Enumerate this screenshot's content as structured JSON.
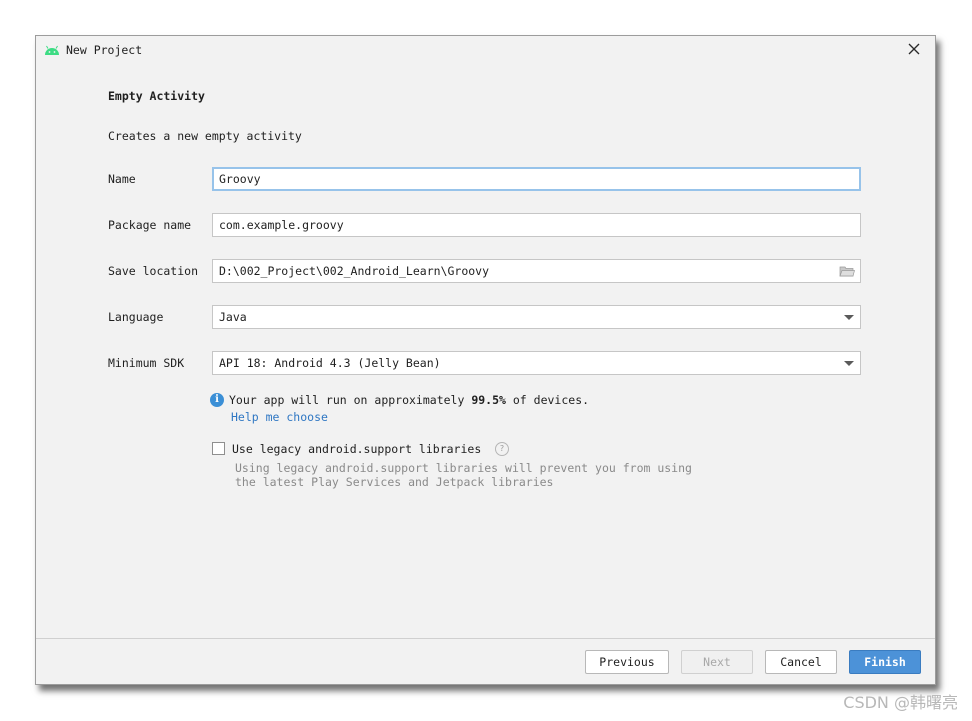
{
  "window": {
    "title": "New Project",
    "close_glyph": "✕"
  },
  "form": {
    "heading": "Empty Activity",
    "description": "Creates a new empty activity",
    "name_label": "Name",
    "name_value": "Groovy",
    "package_label": "Package name",
    "package_value": "com.example.groovy",
    "location_label": "Save location",
    "location_value": "D:\\002_Project\\002_Android_Learn\\Groovy",
    "language_label": "Language",
    "language_value": "Java",
    "sdk_label": "Minimum SDK",
    "sdk_value": "API 18: Android 4.3 (Jelly Bean)"
  },
  "info": {
    "icon_glyph": "i",
    "text_prefix": "Your app will run on approximately ",
    "percent": "99.5%",
    "text_suffix": " of devices.",
    "help_link": "Help me choose"
  },
  "legacy": {
    "checkbox_label": "Use legacy android.support libraries",
    "checked": false,
    "question_glyph": "?",
    "hint_line1": "Using legacy android.support libraries will prevent you from using",
    "hint_line2": "the latest Play Services and Jetpack libraries"
  },
  "buttons": {
    "previous": "Previous",
    "next": "Next",
    "cancel": "Cancel",
    "finish": "Finish"
  },
  "watermark": "CSDN @韩曙亮",
  "colors": {
    "android_green": "#3ddc84",
    "accent_blue": "#4c92d8",
    "link_blue": "#2f77c3",
    "info_blue": "#3b8fd6",
    "focus_border": "#97c3ea"
  }
}
